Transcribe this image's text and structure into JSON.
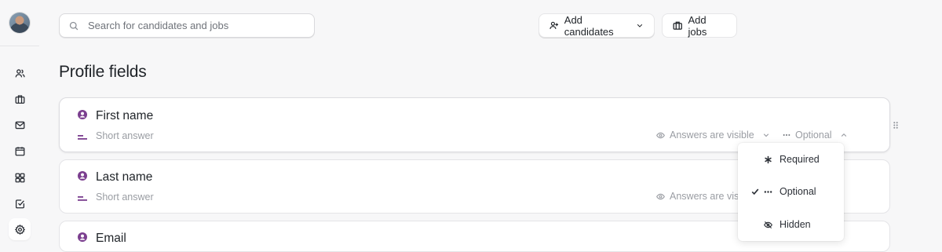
{
  "search": {
    "placeholder": "Search for candidates and jobs"
  },
  "header": {
    "add_candidates_label": "Add candidates",
    "add_jobs_label": "Add jobs"
  },
  "sidebar": {
    "items": [
      {
        "icon": "users-icon",
        "active": false
      },
      {
        "icon": "briefcase-icon",
        "active": false
      },
      {
        "icon": "mail-icon",
        "active": false
      },
      {
        "icon": "calendar-icon",
        "active": false
      },
      {
        "icon": "dashboard-icon",
        "active": false
      },
      {
        "icon": "checkbox-icon",
        "active": false
      },
      {
        "icon": "gear-icon",
        "active": true
      }
    ]
  },
  "page": {
    "title": "Profile fields"
  },
  "fields": [
    {
      "name": "First name",
      "type": "Short answer",
      "visibility": "Answers are visible",
      "requirement": "Optional"
    },
    {
      "name": "Last name",
      "type": "Short answer",
      "visibility": "Answers are visible"
    },
    {
      "name": "Email"
    }
  ],
  "requirement_menu": {
    "options": [
      {
        "label": "Required",
        "icon": "asterisk-icon",
        "selected": false
      },
      {
        "label": "Optional",
        "icon": "dots-icon",
        "selected": true
      },
      {
        "label": "Hidden",
        "icon": "eye-off-icon",
        "selected": false
      }
    ]
  },
  "colors": {
    "accent": "#7b3f8f",
    "muted_text": "#9a9da3",
    "background": "#f7f7f8"
  }
}
